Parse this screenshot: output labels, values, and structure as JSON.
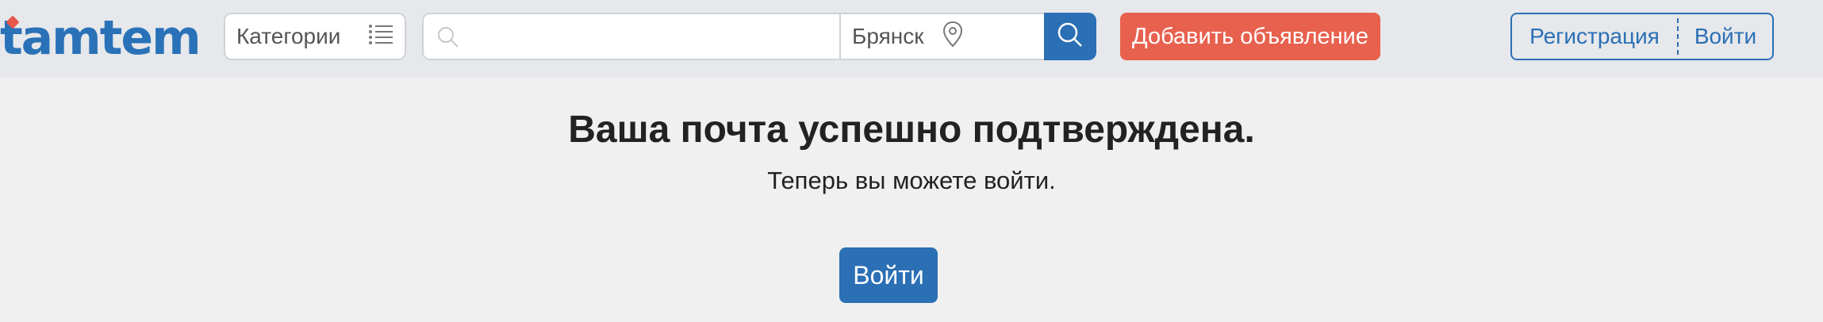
{
  "header": {
    "logo_text": "tamtem",
    "categories_label": "Категории",
    "search_placeholder": "",
    "city": "Брянск",
    "add_ad_label": "Добавить объявление",
    "register_label": "Регистрация",
    "login_label": "Войти"
  },
  "main": {
    "title": "Ваша почта успешно подтверждена.",
    "subtitle": "Теперь вы можете войти.",
    "login_button": "Войти"
  },
  "colors": {
    "brand_blue": "#2b6fb5",
    "accent_red": "#e8614f",
    "header_bg": "#e6e8eb",
    "page_bg": "#f0f0f0"
  }
}
